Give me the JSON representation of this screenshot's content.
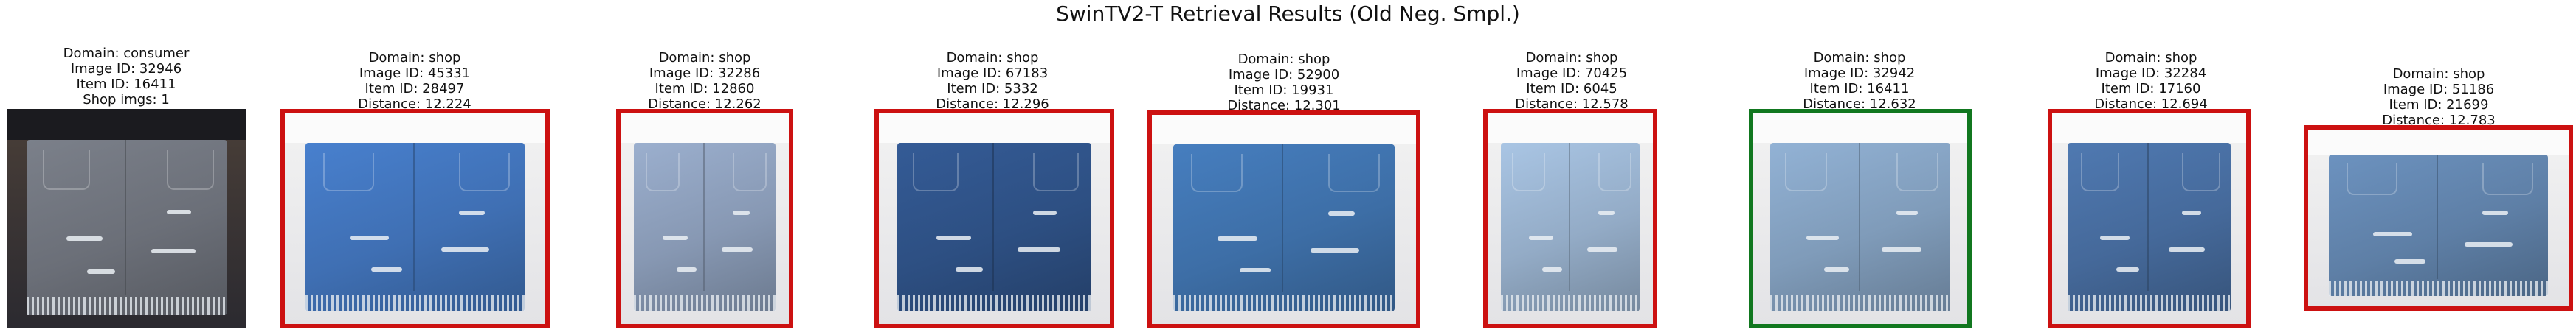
{
  "figure_title": "SwinTV2-T Retrieval Results (Old Neg. Smpl.)",
  "colors": {
    "match_border": "#11771f",
    "mismatch_border": "#cc1111"
  },
  "panels": [
    {
      "lines": [
        "Domain: consumer",
        "Image ID: 32946",
        "Item ID: 16411",
        "Shop imgs: 1"
      ],
      "match": null,
      "wash": "#6b6f78"
    },
    {
      "lines": [
        "Domain: shop",
        "Image ID: 45331",
        "Item ID: 28497",
        "Distance: 12.224"
      ],
      "match": false,
      "wash": "#3f6fb3"
    },
    {
      "lines": [
        "Domain: shop",
        "Image ID: 32286",
        "Item ID: 12860",
        "Distance: 12.262"
      ],
      "match": false,
      "wash": "#8798b3"
    },
    {
      "lines": [
        "Domain: shop",
        "Image ID: 67183",
        "Item ID: 5332",
        "Distance: 12.296"
      ],
      "match": false,
      "wash": "#2d4f82"
    },
    {
      "lines": [
        "Domain: shop",
        "Image ID: 52900",
        "Item ID: 19931",
        "Distance: 12.301"
      ],
      "match": false,
      "wash": "#3d6ea6"
    },
    {
      "lines": [
        "Domain: shop",
        "Image ID: 70425",
        "Item ID: 6045",
        "Distance: 12.578"
      ],
      "match": false,
      "wash": "#93abc6"
    },
    {
      "lines": [
        "Domain: shop",
        "Image ID: 32942",
        "Item ID: 16411",
        "Distance: 12.632"
      ],
      "match": true,
      "wash": "#7f9bb9"
    },
    {
      "lines": [
        "Domain: shop",
        "Image ID: 32284",
        "Item ID: 17160",
        "Distance: 12.694"
      ],
      "match": false,
      "wash": "#45699a"
    },
    {
      "lines": [
        "Domain: shop",
        "Image ID: 51186",
        "Item ID: 21699",
        "Distance: 12.783"
      ],
      "match": false,
      "wash": "#5e7fa6"
    }
  ]
}
